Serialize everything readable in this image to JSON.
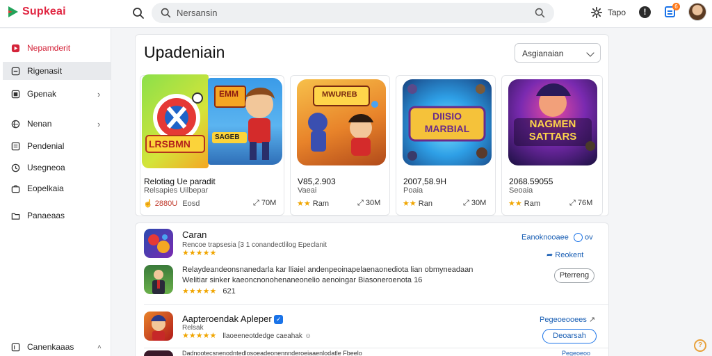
{
  "app": {
    "name": "Supkeai"
  },
  "search": {
    "placeholder": "Nersansin"
  },
  "topbar": {
    "label": "Tapo",
    "alert_glyph": "!",
    "notification_count": "6"
  },
  "sidebar": {
    "items": [
      {
        "label": "Nepamderit",
        "icon": "play-icon",
        "active": true
      },
      {
        "label": "Rigenasit",
        "icon": "square-icon",
        "selected": true
      },
      {
        "label": "Gpenak",
        "icon": "grid-icon",
        "chevron": true
      },
      {
        "label": "Nenan",
        "icon": "globe-icon",
        "chevron": true
      },
      {
        "label": "Pendenial",
        "icon": "doc-icon"
      },
      {
        "label": "Usegneoa",
        "icon": "clock-icon"
      },
      {
        "label": "Eopelkaia",
        "icon": "bag-icon"
      },
      {
        "label": "Panaeaas",
        "icon": "folder-icon"
      }
    ],
    "footer": {
      "label": "Canenkaaas",
      "chevron": "˄"
    }
  },
  "featured": {
    "title": "Upadeniain",
    "dropdown": {
      "selected": "Asgianaian"
    },
    "cards": [
      {
        "thumb_text": "LRSBMN",
        "thumb_text_2": "EMM",
        "thumb_text_3": "SAGEB",
        "title": "Relotiag  Ue  paradit",
        "subtitle": "Relsapies  Uilbepar",
        "rating_text": "2880U",
        "rating_label": "Eosd",
        "downloads": "70M"
      },
      {
        "thumb_text": "MWUREB",
        "title": "V85,2.903",
        "subtitle": "Vaeai",
        "rating_label": "Ram",
        "downloads": "30M"
      },
      {
        "thumb_text": "DIISIO MARBIAL",
        "title": "2007,58.9H",
        "subtitle": "Poaia",
        "rating_label": "Ran",
        "downloads": "30M"
      },
      {
        "thumb_text": "NAGMEN SATTARS",
        "title": "2068.59055",
        "subtitle": "Seoaia",
        "rating_label": "Ram",
        "downloads": "76M"
      }
    ]
  },
  "list": {
    "rows": [
      {
        "title": "Caran",
        "subtitle": "Rencoe trapsesia   [3 1   conandectlilog Epeclanit",
        "stars": "★★★★★",
        "action_link": "Eanoknooaee",
        "action_extra": "ov",
        "action_button": "Reokent"
      },
      {
        "text_1": "Relaydeandeonsnanedarla kar  lliaiel  andenpeoinapelaenaonediota  lian  obmyneadaan",
        "text_2": "Welitiar sinker  kaeoncnonohenaneonelio  aenoingar  Biasoneroenota  16",
        "stars": "★★★★★",
        "rating_count": "621",
        "action_button": "Pterreng"
      },
      {
        "title": "Aapteroendak  Apleper",
        "subtitle": "Relsak",
        "subtitle_2": "llaoeeneotdedge caeahak",
        "stars": "★★★★★",
        "action_link": "Pegeoeooees",
        "action_button": "Deoarsah"
      },
      {
        "text_1": "Dadnootecsnenodntedlosoeadeonennnderoeiaaenlodatle  Fbeelo",
        "action_link": "Pegeoeoo"
      }
    ]
  },
  "colors": {
    "brand": "#e02440",
    "accent": "#1a73e8",
    "star": "#f0a500"
  }
}
